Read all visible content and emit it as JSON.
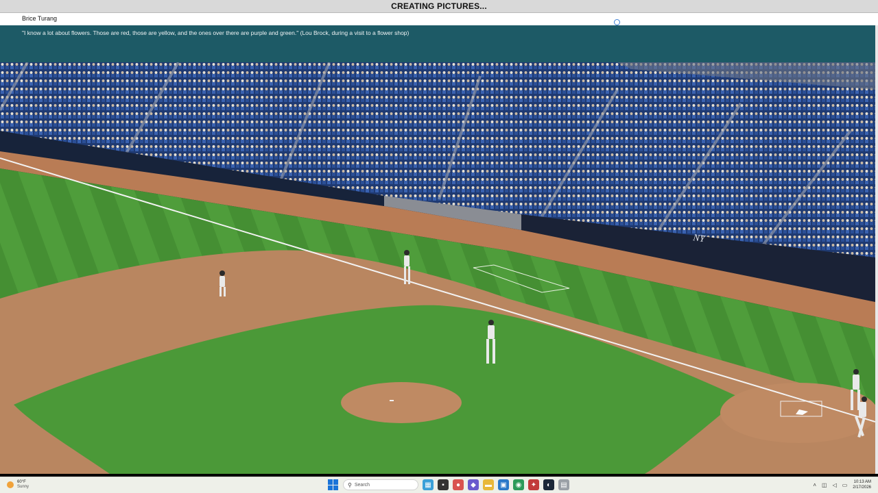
{
  "window": {
    "title": "CREATING PICTURES..."
  },
  "player": {
    "name": "Brice Turang"
  },
  "quote": {
    "text": "\"I know a lot about flowers. Those are red, those are yellow, and the ones over there are purple and green.\" (Lou Brock, during a visit to a flower shop)"
  },
  "scene": {
    "description_icons": [
      "ballpark-scene"
    ],
    "colors": {
      "grass_light": "#4e9a3a",
      "grass_dark": "#3f8a2f",
      "dirt": "#b7805a",
      "wall": "#1b2a44",
      "seats": "#2c4a86",
      "quote_bar": "#1d5a66"
    }
  },
  "taskbar": {
    "weather": {
      "temp": "60°F",
      "condition": "Sunny"
    },
    "search_placeholder": "Search",
    "clock": {
      "time": "10:13 AM",
      "date": "2/17/2026"
    },
    "icons": [
      "start-icon",
      "search-icon",
      "widgets-icon",
      "file-explorer-icon",
      "store-icon",
      "edge-icon",
      "chrome-icon",
      "steam-icon",
      "app-icon"
    ]
  }
}
